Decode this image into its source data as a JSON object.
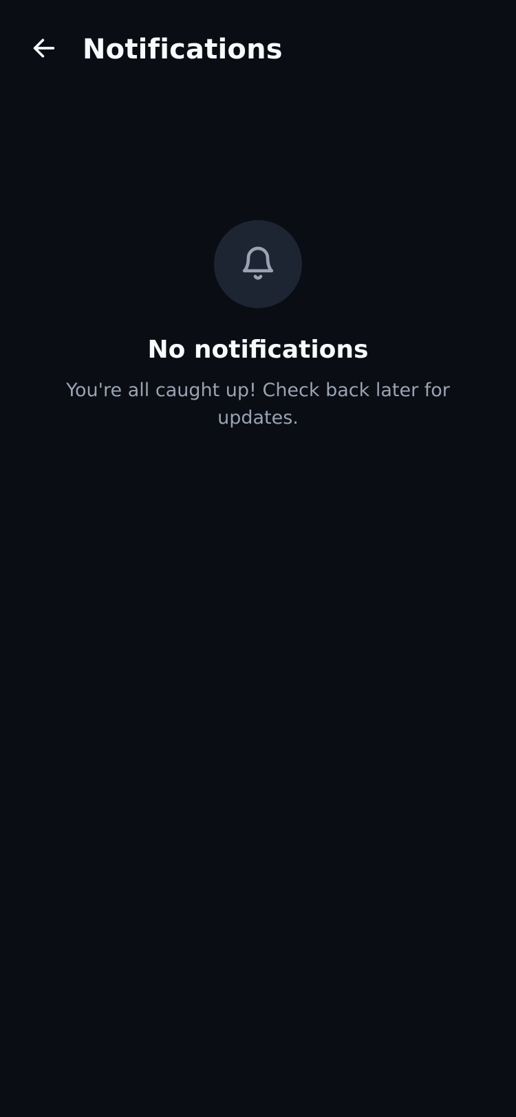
{
  "header": {
    "back_icon": "arrow-left-icon",
    "title": "Notifications"
  },
  "empty_state": {
    "icon": "bell-icon",
    "title": "No notifications",
    "message": "You're all caught up! Check back later for updates."
  },
  "colors": {
    "background": "#0a0d14",
    "icon_circle": "#1d2533",
    "title_text": "#f8fafc",
    "secondary_text": "#9aa3b2"
  }
}
